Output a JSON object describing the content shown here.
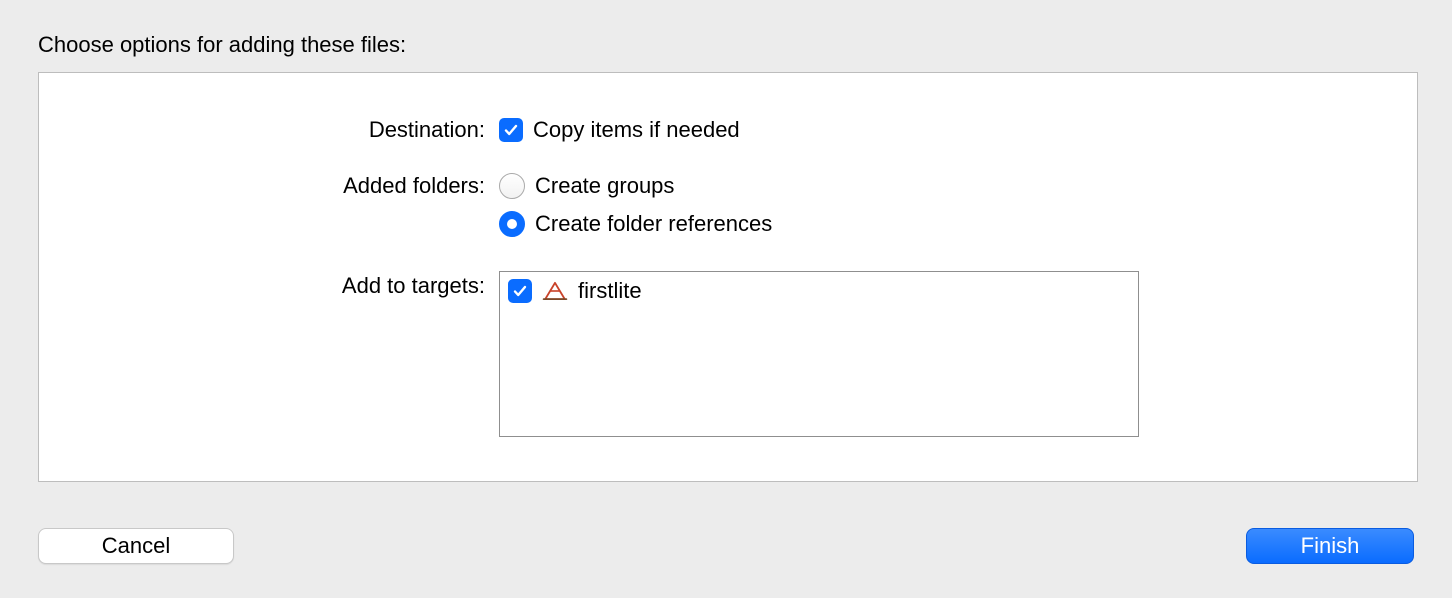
{
  "title": "Choose options for adding these files:",
  "destination": {
    "label": "Destination:",
    "copy_items_label": "Copy items if needed",
    "copy_items_checked": true
  },
  "added_folders": {
    "label": "Added folders:",
    "create_groups_label": "Create groups",
    "create_folder_refs_label": "Create folder references",
    "selected": "references"
  },
  "add_to_targets": {
    "label": "Add to targets:",
    "targets": [
      {
        "name": "firstlite",
        "checked": true
      }
    ]
  },
  "buttons": {
    "cancel": "Cancel",
    "finish": "Finish"
  }
}
